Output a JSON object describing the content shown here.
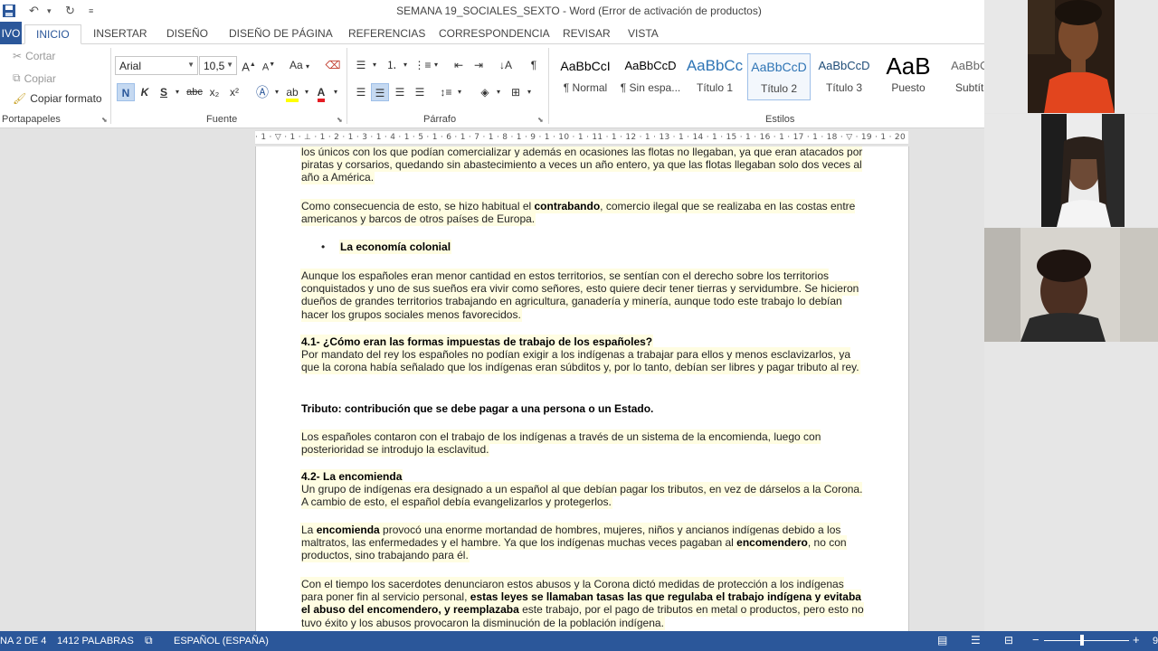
{
  "window": {
    "title": "SEMANA 19_SOCIALES_SEXTO - Word (Error de activación de productos)"
  },
  "tabs": [
    {
      "label": "IVO"
    },
    {
      "label": "INICIO"
    },
    {
      "label": "INSERTAR"
    },
    {
      "label": "DISEÑO"
    },
    {
      "label": "DISEÑO DE PÁGINA"
    },
    {
      "label": "REFERENCIAS"
    },
    {
      "label": "CORRESPONDENCIA"
    },
    {
      "label": "REVISAR"
    },
    {
      "label": "VISTA"
    }
  ],
  "clipboard": {
    "cut": "Cortar",
    "copy": "Copiar",
    "format_painter": "Copiar formato",
    "group_label": "Portapapeles"
  },
  "font": {
    "family": "Arial",
    "size": "10,5",
    "change_case": "Aa",
    "group_label": "Fuente",
    "bold": "N",
    "italic": "K",
    "underline": "S",
    "strike": "abc",
    "subscript": "x₂",
    "superscript": "x²",
    "grow": "A",
    "shrink": "A"
  },
  "paragraph": {
    "group_label": "Párrafo"
  },
  "styles": {
    "group_label": "Estilos",
    "items": [
      {
        "sample": "AaBbCcI",
        "name": "¶ Normal"
      },
      {
        "sample": "AaBbCcD",
        "name": "¶ Sin espa..."
      },
      {
        "sample": "AaBbCc",
        "name": "Título 1"
      },
      {
        "sample": "AaBbCcD",
        "name": "Título 2"
      },
      {
        "sample": "AaBbCcD",
        "name": "Título 3"
      },
      {
        "sample": "AaB",
        "name": "Puesto"
      },
      {
        "sample": "AaBbCc",
        "name": "Subtítu"
      }
    ]
  },
  "ruler": {
    "text": "· 1 · ▽ · 1 · ⊥ · 1 · 2 · 1 · 3 · 1 · 4 · 1 · 5 · 1 · 6 · 1 · 7 · 1 · 8 · 1 · 9 · 1 · 10 · 1 · 11 · 1 · 12 · 1 · 13 · 1 · 14 · 1 · 15 · 1 · 16 · 1 · 17 · 1 · 18 · ▽ · 19 · 1 · 20"
  },
  "document": {
    "p1": "los únicos con los que podían comercializar y además en ocasiones las flotas no llegaban, ya que eran atacados por piratas y corsarios, quedando sin abastecimiento a veces un año entero, ya que las flotas llegaban solo dos veces al año a América.",
    "p2_a": "Como consecuencia de esto, se hizo habitual el ",
    "p2_b": "contrabando",
    "p2_c": ", comercio ilegal que se realizaba en las costas entre americanos y barcos de otros países de Europa.",
    "bullet": "La economía colonial",
    "p3": "Aunque los españoles eran menor cantidad en estos territorios, se sentían con el derecho sobre los territorios conquistados y uno de sus sueños era vivir como señores, esto quiere decir tener tierras y servidumbre. Se hicieron dueños de grandes territorios trabajando en agricultura, ganadería y minería, aunque todo este trabajo lo debían hacer los grupos sociales menos favorecidos.",
    "h41": "4.1- ¿Cómo eran las formas impuestas de trabajo de los españoles?",
    "p4": "Por mandato del rey los españoles no podían exigir a los indígenas a trabajar para ellos y menos esclavizarlos, ya que la corona había señalado que los indígenas eran súbditos y, por lo tanto, debían ser libres y pagar tributo al rey.",
    "tributo": "Tributo: contribución que se debe pagar a una persona o un Estado.",
    "p5": "Los españoles contaron con el trabajo de los indígenas a través de un sistema de la encomienda, luego con posterioridad se introdujo la esclavitud.",
    "h42": "4.2- La encomienda",
    "p6": "Un grupo de indígenas era designado a un español al que debían pagar los tributos, en vez de dárselos a la Corona. A cambio de esto, el español debía evangelizarlos y protegerlos.",
    "p7_a": "La ",
    "p7_b": "encomienda",
    "p7_c": " provocó una enorme mortandad de hombres, mujeres, niños y ancianos indígenas debido a los maltratos, las enfermedades y el hambre. Ya que los indígenas muchas veces pagaban al ",
    "p7_d": "encomendero",
    "p7_e": ", no con productos, sino trabajando para él.",
    "p8_a": "Con el tiempo los sacerdotes denunciaron estos abusos y la Corona dictó medidas de protección a los indígenas para poner fin al servicio personal, ",
    "p8_b": "estas leyes se llamaban tasas las que regulaba el trabajo indígena y evitaba el abuso del encomendero, y reemplazaba",
    "p8_c": " este trabajo, por el pago de tributos en metal o productos, pero esto no tuvo éxito y los abusos provocaron la disminución de la población indígena."
  },
  "status": {
    "page": "NA 2 DE 4",
    "words": "1412 PALABRAS",
    "language": "ESPAÑOL (ESPAÑA)",
    "zoom_edge": "9"
  },
  "colors": {
    "accent": "#2b579a",
    "highlight": "#fffde2"
  }
}
